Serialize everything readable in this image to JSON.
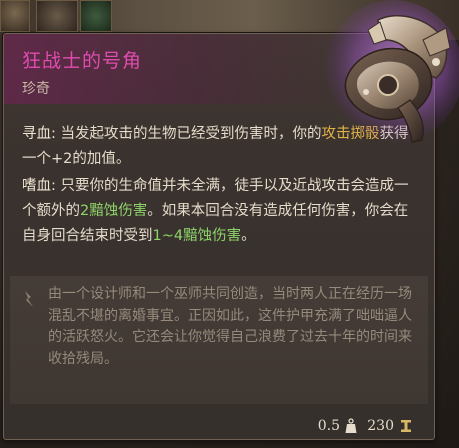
{
  "item": {
    "name": "狂战士的号角",
    "rarity": "珍奇",
    "rarity_color": "#e04cae"
  },
  "effects": [
    {
      "label": "寻血",
      "parts": [
        {
          "text": "寻血: ",
          "style": "label"
        },
        {
          "text": "当发起攻击的生物已经受到伤害时，你的",
          "style": "plain"
        },
        {
          "text": "攻击掷骰",
          "style": "kw-link"
        },
        {
          "text": "获得一个+2的加值。",
          "style": "plain"
        }
      ]
    },
    {
      "label": "嗜血",
      "parts": [
        {
          "text": "嗜血: ",
          "style": "label"
        },
        {
          "text": "只要你的生命值并未全满，徒手以及近战攻击会造成一个额外的",
          "style": "plain"
        },
        {
          "text": "2黯蚀伤害",
          "style": "kw-dmg"
        },
        {
          "text": "。如果本回合没有造成任何伤害，你会在自身回合结束时受到",
          "style": "plain"
        },
        {
          "text": "1~4黯蚀伤害",
          "style": "kw-dmg"
        },
        {
          "text": "。",
          "style": "plain"
        }
      ]
    }
  ],
  "flavor": {
    "icon": "quill-icon",
    "text": "由一个设计师和一个巫师共同创造，当时两人正在经历一场混乱不堪的离婚事宜。正因如此，这件护甲充满了咄咄逼人的活跃怒火。它还会让你觉得自己浪费了过去十年的时间来收拾残局。"
  },
  "footer": {
    "weight": "0.5",
    "weight_icon": "weight-icon",
    "value": "230",
    "value_icon": "gold-coin-icon"
  },
  "colors": {
    "link": "#e0b24a",
    "damage": "#8fd46a",
    "text": "#e6dccb",
    "flavor": "#958a7c"
  }
}
